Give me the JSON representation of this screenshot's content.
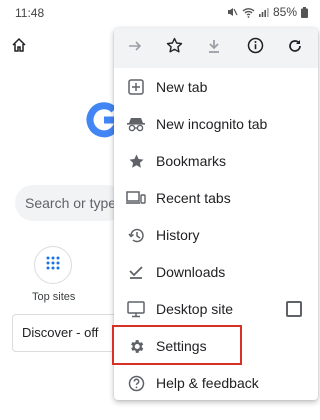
{
  "status_bar": {
    "time": "11:48",
    "battery": "85%"
  },
  "background": {
    "search_placeholder": "Search or type",
    "top_sites_label": "Top sites",
    "discover_label": "Discover - off"
  },
  "menu": {
    "items": [
      {
        "label": "New tab",
        "icon": "new-tab-icon"
      },
      {
        "label": "New incognito tab",
        "icon": "incognito-icon"
      },
      {
        "label": "Bookmarks",
        "icon": "star-filled-icon"
      },
      {
        "label": "Recent tabs",
        "icon": "devices-icon"
      },
      {
        "label": "History",
        "icon": "history-icon"
      },
      {
        "label": "Downloads",
        "icon": "download-done-icon"
      },
      {
        "label": "Desktop site",
        "icon": "desktop-icon",
        "checked": false
      },
      {
        "label": "Settings",
        "icon": "gear-icon",
        "highlighted": true
      },
      {
        "label": "Help & feedback",
        "icon": "help-icon"
      }
    ]
  },
  "colors": {
    "highlight": "#d93025",
    "menu_top_bg": "#f1f3f4",
    "google_blue": "#4285f4"
  }
}
